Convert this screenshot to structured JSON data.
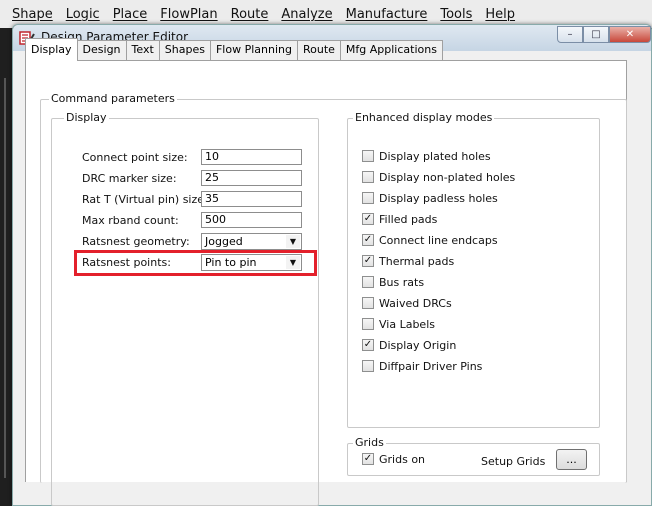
{
  "menubar": [
    "Shape",
    "Logic",
    "Place",
    "FlowPlan",
    "Route",
    "Analyze",
    "Manufacture",
    "Tools",
    "Help"
  ],
  "window": {
    "title": "Design Parameter Editor",
    "close_glyph": "✕",
    "min_glyph": "–",
    "max_glyph": "□"
  },
  "tabs": [
    "Display",
    "Design",
    "Text",
    "Shapes",
    "Flow Planning",
    "Route",
    "Mfg Applications"
  ],
  "command_params": {
    "label": "Command parameters"
  },
  "display": {
    "label": "Display",
    "fields": [
      {
        "label": "Connect point size:",
        "value": "10"
      },
      {
        "label": "DRC marker size:",
        "value": "25"
      },
      {
        "label": "Rat T (Virtual pin) size:",
        "value": "35"
      },
      {
        "label": "Max rband count:",
        "value": "500"
      }
    ],
    "ratsnest_geometry": {
      "label": "Ratsnest geometry:",
      "value": "Jogged"
    },
    "ratsnest_points": {
      "label": "Ratsnest points:",
      "value": "Pin to pin"
    },
    "dropdown_glyph": "▼"
  },
  "enhanced": {
    "label": "Enhanced display modes",
    "options": [
      {
        "label": "Display plated holes",
        "checked": false
      },
      {
        "label": "Display non-plated holes",
        "checked": false
      },
      {
        "label": "Display padless holes",
        "checked": false
      },
      {
        "label": "Filled pads",
        "checked": true
      },
      {
        "label": "Connect line endcaps",
        "checked": true
      },
      {
        "label": "Thermal pads",
        "checked": true
      },
      {
        "label": "Bus rats",
        "checked": false
      },
      {
        "label": "Waived DRCs",
        "checked": false
      },
      {
        "label": "Via Labels",
        "checked": false
      },
      {
        "label": "Display Origin",
        "checked": true
      },
      {
        "label": "Diffpair Driver Pins",
        "checked": false
      }
    ],
    "check_glyph": "✓"
  },
  "grids": {
    "label": "Grids",
    "grids_on_label": "Grids on",
    "grids_on_checked": true,
    "setup_label": "Setup Grids",
    "setup_button": "..."
  },
  "colors": {
    "highlight": "#e3202b"
  }
}
